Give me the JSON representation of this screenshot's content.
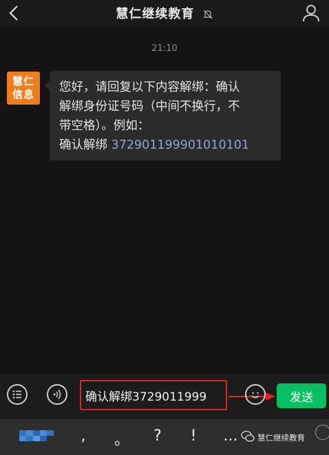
{
  "header": {
    "title": "慧仁继续教育",
    "back_icon": "chevron-left-icon",
    "mute_icon": "bell-off-icon",
    "profile_icon": "person-icon"
  },
  "chat": {
    "timestamp": "21:10",
    "sender_avatar": {
      "line1": "慧仁",
      "line2": "信息",
      "bg_color": "#f07d1a"
    },
    "message": {
      "line1": "您好，请回复以下内容解绑：确认",
      "line2": "解绑身份证号码（中间不换行，不",
      "line3": "带空格）。例如：",
      "line4_prefix": "确认解绑 ",
      "line4_number": "372901199901010101"
    }
  },
  "input_bar": {
    "input_value": "确认解绑3729011999",
    "send_label": "发送",
    "send_color": "#07c160",
    "highlight_color": "#e02424",
    "list_icon": "list-icon",
    "voice_icon": "voice-icon",
    "emoji_icon": "emoji-icon"
  },
  "keyboard": {
    "keys": [
      ",",
      "。",
      "?",
      "!",
      "..."
    ],
    "watermark": "慧仁继续教育"
  }
}
